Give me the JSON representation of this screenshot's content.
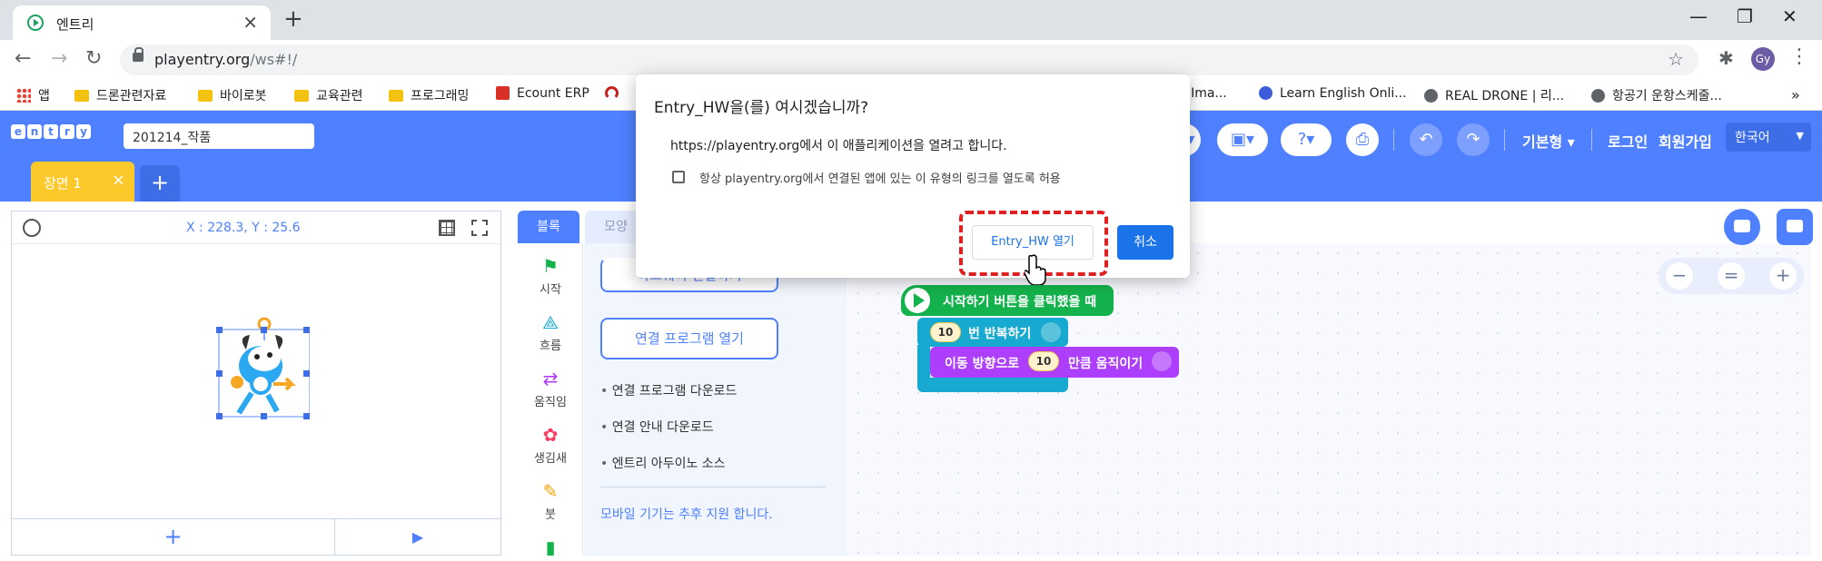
{
  "browser": {
    "tab_title": "엔트리",
    "url_host": "playentry.org",
    "url_path": "/ws#!/",
    "avatar_initials": "Gy",
    "bookmarks": [
      {
        "label": "앱",
        "type": "apps"
      },
      {
        "label": "드론관련자료",
        "type": "folder"
      },
      {
        "label": "바이로봇",
        "type": "folder"
      },
      {
        "label": "교육관련",
        "type": "folder"
      },
      {
        "label": "프로그래밍",
        "type": "folder"
      },
      {
        "label": "Ecount ERP",
        "type": "site"
      },
      {
        "label": "e Ima...",
        "type": "site"
      },
      {
        "label": "Learn English Onli...",
        "type": "site"
      },
      {
        "label": "REAL DRONE | 리...",
        "type": "site"
      },
      {
        "label": "항공기 운항스케줄...",
        "type": "site"
      }
    ],
    "bookmarks_overflow": "»"
  },
  "entry": {
    "logo_letters": [
      "e",
      "n",
      "t",
      "r",
      "y"
    ],
    "project_name": "201214_작품",
    "scene_tab": "장면 1",
    "header": {
      "mode_label": "기본형",
      "login": "로그인",
      "signup": "회원가입",
      "language": "한국어"
    },
    "stage": {
      "coords": "X : 228.3,  Y : 25.6"
    },
    "palette_tabs": [
      "블록",
      "모양"
    ],
    "categories": [
      {
        "label": "시작",
        "icon": "flag-icon",
        "color": "#14b24c"
      },
      {
        "label": "흐름",
        "icon": "flow-icon",
        "color": "#17a9cf"
      },
      {
        "label": "움직임",
        "icon": "move-icon",
        "color": "#ad3efb"
      },
      {
        "label": "생김새",
        "icon": "looks-icon",
        "color": "#ff3a61"
      },
      {
        "label": "붓",
        "icon": "brush-icon",
        "color": "#ffa000"
      }
    ],
    "hardware": {
      "connect_button": "하드웨어 연결하기",
      "open_program_button": "연결 프로그램 열기",
      "links": [
        "연결 프로그램 다운로드",
        "연결 안내 다운로드",
        "엔트리 아두이노 소스"
      ],
      "note": "모바일 기기는 추후 지원 합니다."
    },
    "blocks": {
      "start": "시작하기 버튼을 클릭했을 때",
      "repeat_count": "10",
      "repeat_label": "번 반복하기",
      "move_prefix": "이동 방향으로",
      "move_count": "10",
      "move_suffix": "만큼 움직이기"
    },
    "zoom": {
      "minus": "−",
      "reset": "=",
      "plus": "+"
    }
  },
  "dialog": {
    "title": "Entry_HW을(를) 여시겠습니까?",
    "message": "https://playentry.org에서 이 애플리케이션을 열려고 합니다.",
    "checkbox_label": "항상 playentry.org에서 연결된 앱에 있는 이 유형의 링크를 열도록 허용",
    "open_button": "Entry_HW 열기",
    "cancel_button": "취소"
  },
  "colors": {
    "entry_blue": "#4f80ff",
    "highlight_red": "#e02020",
    "chrome_blue": "#1a73e8"
  }
}
